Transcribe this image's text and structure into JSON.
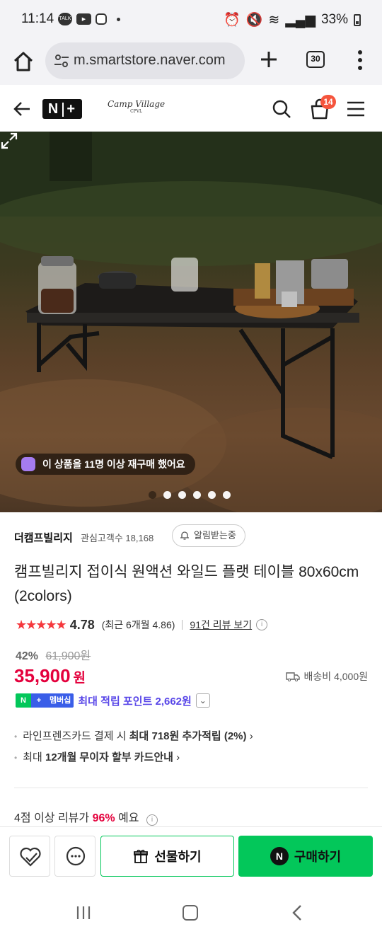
{
  "status": {
    "time": "11:14",
    "battery": "33%",
    "notif_talk": "TALK"
  },
  "browser": {
    "url": "m.smartstore.naver.com",
    "tab_count": "30"
  },
  "header": {
    "brand_badge": "N+",
    "store_logo": "Camp Village",
    "store_logo_sub": "CPVL",
    "cart_count": "14"
  },
  "hero": {
    "rebuy_notice": "이 상품을 11명 이상 재구매 했어요",
    "slide_count": 6,
    "active_slide": 1
  },
  "seller": {
    "name": "더캠프빌리지",
    "followers": "관심고객수 18,168",
    "alarm_label": "알림받는중"
  },
  "product": {
    "title": "캠프빌리지 접이식 원액션 와일드 플랫 테이블 80x60cm (2colors)",
    "rating": "4.78",
    "rating_recent": "(최근 6개월 4.86)",
    "review_link": "91건 리뷰 보기",
    "discount_rate": "42%",
    "original_price": "61,900원",
    "price": "35,900",
    "price_unit": "원",
    "shipping": "배송비 4,000원"
  },
  "membership": {
    "badge_text": "멤버십",
    "point_text": "최대 적립 포인트 2,662원"
  },
  "benefits": {
    "line1_prefix": "라인프렌즈카드 결제 시 ",
    "line1_bold": "최대 718원 추가적립 (2%)",
    "line2_prefix": "최대 ",
    "line2_bold": "12개월 무이자 할부 카드안내"
  },
  "review_summary": {
    "prefix": "4점 이상 리뷰가 ",
    "highlight": "96%",
    "suffix": " 예요"
  },
  "actions": {
    "gift_label": "선물하기",
    "buy_label": "구매하기",
    "npay_icon": "N"
  },
  "colors": {
    "naver_green": "#03c75a",
    "price_red": "#e4003c",
    "star_red": "#f5383d",
    "membership_purple": "#5846e8"
  }
}
